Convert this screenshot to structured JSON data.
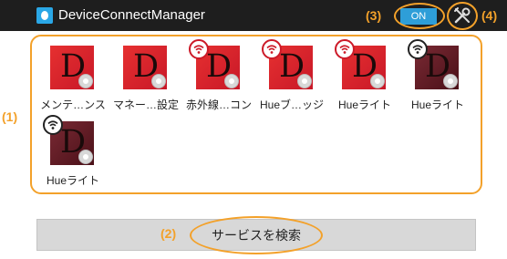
{
  "header": {
    "title": "DeviceConnectManager",
    "toggle_label": "ON",
    "settings_icon": "tools-icon"
  },
  "devices": [
    {
      "label": "メンテ…ンス",
      "wifi": "none",
      "tile": "red"
    },
    {
      "label": "マネー…設定",
      "wifi": "none",
      "tile": "red"
    },
    {
      "label": "赤外線…コン",
      "wifi": "red",
      "tile": "red"
    },
    {
      "label": "Hueブ…ッジ",
      "wifi": "red",
      "tile": "red"
    },
    {
      "label": "Hueライト",
      "wifi": "red",
      "tile": "red"
    },
    {
      "label": "Hueライト",
      "wifi": "black",
      "tile": "dark"
    },
    {
      "label": "Hueライト",
      "wifi": "black",
      "tile": "dark"
    }
  ],
  "tile_letter": "D",
  "search_button_label": "サービスを検索",
  "annotations": {
    "grid": "(1)",
    "search": "(2)",
    "toggle": "(3)",
    "settings": "(4)"
  },
  "colors": {
    "accent": "#f3a12a",
    "toggle_on": "#2e9ed8",
    "titlebar": "#1e1e1e",
    "tile_red": "#e63030",
    "tile_dark": "#5a1a22"
  }
}
